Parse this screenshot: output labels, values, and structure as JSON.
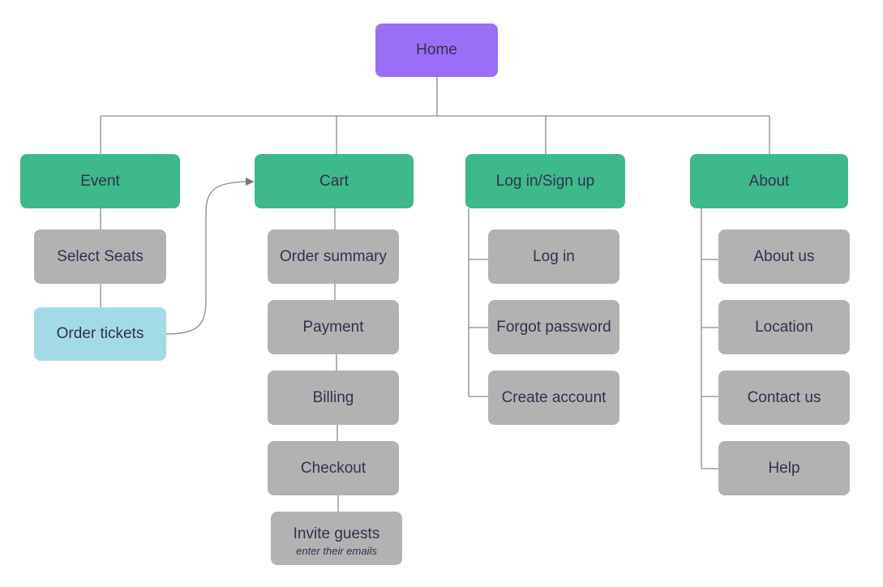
{
  "colors": {
    "root": "#9a6ef7",
    "section": "#3db98b",
    "page": "#b2b2b2",
    "highlight": "#a2dbe6",
    "text": "#35304f",
    "line": "#8a8a8a"
  },
  "root": {
    "label": "Home"
  },
  "sections": [
    {
      "label": "Event",
      "children": [
        {
          "label": "Select Seats"
        },
        {
          "label": "Order tickets",
          "highlight": true
        }
      ]
    },
    {
      "label": "Cart",
      "children": [
        {
          "label": "Order summary"
        },
        {
          "label": "Payment"
        },
        {
          "label": "Billing"
        },
        {
          "label": "Checkout"
        },
        {
          "label": "Invite guests",
          "note": "enter their emails"
        }
      ]
    },
    {
      "label": "Log in/Sign up",
      "children": [
        {
          "label": "Log in"
        },
        {
          "label": "Forgot password"
        },
        {
          "label": "Create account"
        }
      ]
    },
    {
      "label": "About",
      "children": [
        {
          "label": "About us"
        },
        {
          "label": "Location"
        },
        {
          "label": "Contact us"
        },
        {
          "label": "Help"
        }
      ]
    }
  ],
  "links": [
    {
      "from": "Order tickets",
      "to": "Cart"
    }
  ]
}
